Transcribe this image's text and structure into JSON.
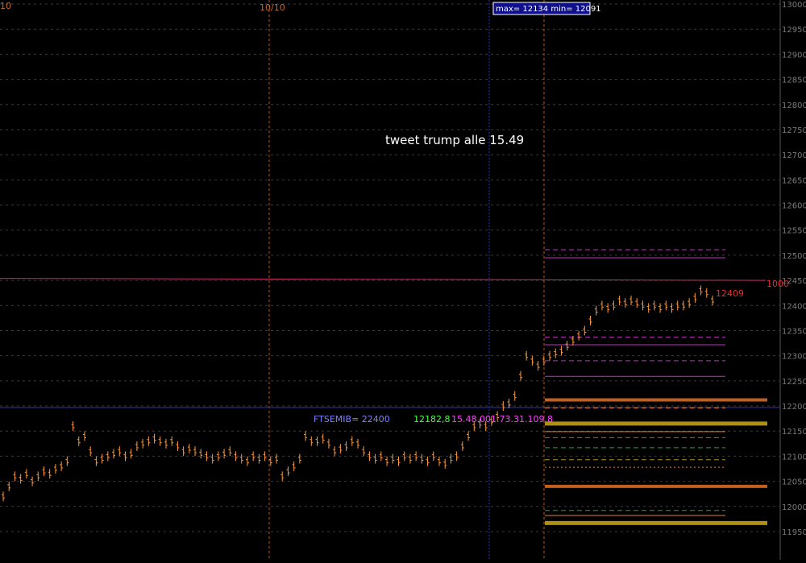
{
  "chart_data": {
    "type": "line",
    "title": "",
    "date_label": "10/10",
    "left_edge_label": "10",
    "range_box": "max= 12134 min= 12091",
    "annotation_text": "tweet trump alle 15.49",
    "last_price_label": "12409",
    "ma_label": "1000",
    "info_labels": [
      {
        "text": "FTSEMIB= 22400",
        "color": "#8080ff"
      },
      {
        "text": "12182,8",
        "color": "#40ff40"
      },
      {
        "text": "15.48.00",
        "color": "#ff40ff"
      },
      {
        "text": "1.73.31.109.8",
        "color": "#ff40ff"
      }
    ],
    "ylim": [
      11950,
      13000
    ],
    "y_ticks": [
      "13000",
      "12950",
      "12900",
      "12850",
      "12800",
      "12750",
      "12700",
      "12650",
      "12600",
      "12550",
      "12500",
      "12450",
      "12400",
      "12350",
      "12300",
      "12250",
      "12200",
      "12150",
      "12100",
      "12050",
      "12000",
      "11950"
    ],
    "series": [
      {
        "color": "#ff9a3c",
        "values": [
          12020,
          12040,
          12060,
          12055,
          12065,
          12050,
          12060,
          12070,
          12065,
          12075,
          12080,
          12090,
          12160,
          12130,
          12140,
          12110,
          12090,
          12095,
          12100,
          12105,
          12110,
          12100,
          12105,
          12120,
          12125,
          12130,
          12135,
          12130,
          12125,
          12130,
          12120,
          12110,
          12115,
          12110,
          12105,
          12100,
          12095,
          12100,
          12105,
          12110,
          12100,
          12095,
          12090,
          12100,
          12095,
          12100,
          12090,
          12095,
          12060,
          12070,
          12080,
          12095,
          12140,
          12130,
          12130,
          12135,
          12125,
          12110,
          12115,
          12120,
          12130,
          12125,
          12110,
          12100,
          12095,
          12100,
          12090,
          12095,
          12090,
          12100,
          12095,
          12100,
          12095,
          12090,
          12100,
          12090,
          12085,
          12095,
          12100,
          12120,
          12140,
          12160,
          12165,
          12160,
          12170,
          12180,
          12200,
          12205,
          12220,
          12260,
          12300,
          12290,
          12280,
          12290,
          12300,
          12305,
          12310,
          12320,
          12330,
          12340,
          12350,
          12370,
          12390,
          12400,
          12395,
          12400,
          12410,
          12405,
          12410,
          12405,
          12400,
          12395,
          12400,
          12395,
          12400,
          12395,
          12400,
          12400,
          12405,
          12415,
          12430,
          12425,
          12410
        ],
        "x_range": [
          0,
          880
        ]
      },
      {
        "name": "",
        "color": "#c0306a",
        "values": [
          12454,
          12453,
          12452,
          12451,
          12450
        ],
        "x_range": [
          0,
          950
        ]
      }
    ],
    "levels": [
      {
        "value": 12511,
        "color": "#c030c0",
        "style": "dashed",
        "width": 1
      },
      {
        "value": 12495,
        "color": "#c030c0",
        "style": "solid",
        "width": 1
      },
      {
        "value": 12337,
        "color": "#c030c0",
        "style": "dashed",
        "width": 1
      },
      {
        "value": 12322,
        "color": "#c030c0",
        "style": "solid",
        "width": 1
      },
      {
        "value": 12290,
        "color": "#c030c0",
        "style": "dashed",
        "width": 1
      },
      {
        "value": 12259,
        "color": "#c030c0",
        "style": "solid",
        "width": 1
      },
      {
        "value": 12212,
        "color": "#c06020",
        "style": "solid",
        "width": 4
      },
      {
        "value": 12196,
        "color": "#e08040",
        "style": "dashed",
        "width": 1
      },
      {
        "value": 12165,
        "color": "#b09010",
        "style": "solid",
        "width": 5
      },
      {
        "value": 12149,
        "color": "#e08040",
        "style": "solid",
        "width": 1
      },
      {
        "value": 12137,
        "color": "#c06020",
        "style": "dashed",
        "width": 1
      },
      {
        "value": 12117,
        "color": "#30a030",
        "style": "dashed",
        "width": 1
      },
      {
        "value": 12093,
        "color": "#b09010",
        "style": "dashed",
        "width": 1
      },
      {
        "value": 12078,
        "color": "#e08040",
        "style": "dotted",
        "width": 1
      },
      {
        "value": 12040,
        "color": "#c06020",
        "style": "solid",
        "width": 4
      },
      {
        "value": 11992,
        "color": "#30a030",
        "style": "dashed",
        "width": 1
      },
      {
        "value": 11982,
        "color": "#e08040",
        "style": "solid",
        "width": 1
      },
      {
        "value": 11967,
        "color": "#b09010",
        "style": "solid",
        "width": 5
      }
    ],
    "crosshair_value": 12197,
    "grid": true
  }
}
